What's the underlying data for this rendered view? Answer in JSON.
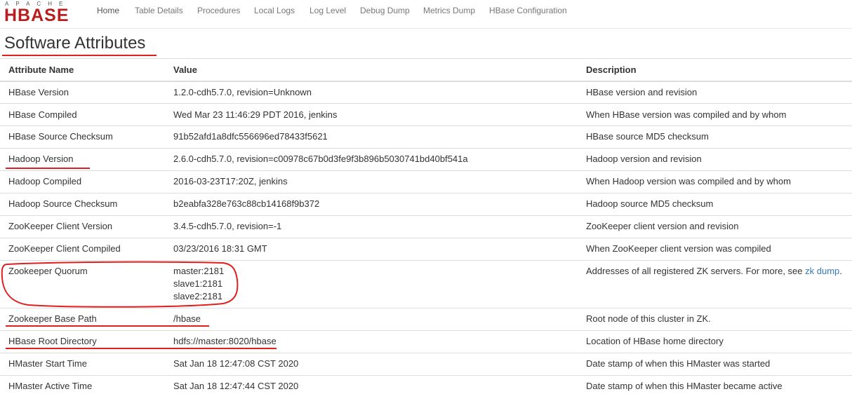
{
  "logo": {
    "top": "APACHE",
    "main": "HBASE"
  },
  "nav": {
    "home": "Home",
    "table_details": "Table Details",
    "procedures": "Procedures",
    "local_logs": "Local Logs",
    "log_level": "Log Level",
    "debug_dump": "Debug Dump",
    "metrics_dump": "Metrics Dump",
    "hbase_configuration": "HBase Configuration"
  },
  "page_title": "Software Attributes",
  "table": {
    "headers": {
      "name": "Attribute Name",
      "value": "Value",
      "description": "Description"
    },
    "rows": [
      {
        "name": "HBase Version",
        "value": "1.2.0-cdh5.7.0, revision=Unknown",
        "description": "HBase version and revision"
      },
      {
        "name": "HBase Compiled",
        "value": "Wed Mar 23 11:46:29 PDT 2016, jenkins",
        "description": "When HBase version was compiled and by whom"
      },
      {
        "name": "HBase Source Checksum",
        "value": "91b52afd1a8dfc556696ed78433f5621",
        "description": "HBase source MD5 checksum"
      },
      {
        "name": "Hadoop Version",
        "value": "2.6.0-cdh5.7.0, revision=c00978c67b0d3fe9f3b896b5030741bd40bf541a",
        "description": "Hadoop version and revision"
      },
      {
        "name": "Hadoop Compiled",
        "value": "2016-03-23T17:20Z, jenkins",
        "description": "When Hadoop version was compiled and by whom"
      },
      {
        "name": "Hadoop Source Checksum",
        "value": "b2eabfa328e763c88cb14168f9b372",
        "description": "Hadoop source MD5 checksum"
      },
      {
        "name": "ZooKeeper Client Version",
        "value": "3.4.5-cdh5.7.0, revision=-1",
        "description": "ZooKeeper client version and revision"
      },
      {
        "name": "ZooKeeper Client Compiled",
        "value": "03/23/2016 18:31 GMT",
        "description": "When ZooKeeper client version was compiled"
      },
      {
        "name": "Zookeeper Quorum",
        "values": [
          "master:2181",
          "slave1:2181",
          "slave2:2181"
        ],
        "description": "Addresses of all registered ZK servers. For more, see ",
        "link": "zk dump",
        "description_suffix": "."
      },
      {
        "name": "Zookeeper Base Path",
        "value": "/hbase",
        "description": "Root node of this cluster in ZK."
      },
      {
        "name": "HBase Root Directory",
        "value": "hdfs://master:8020/hbase",
        "description": "Location of HBase home directory"
      },
      {
        "name": "HMaster Start Time",
        "value": "Sat Jan 18 12:47:08 CST 2020",
        "description": "Date stamp of when this HMaster was started"
      },
      {
        "name": "HMaster Active Time",
        "value": "Sat Jan 18 12:47:44 CST 2020",
        "description": "Date stamp of when this HMaster became active"
      }
    ]
  },
  "colors": {
    "annotation": "#e31e1e",
    "link": "#337ab7",
    "logo": "#b91d1d"
  }
}
